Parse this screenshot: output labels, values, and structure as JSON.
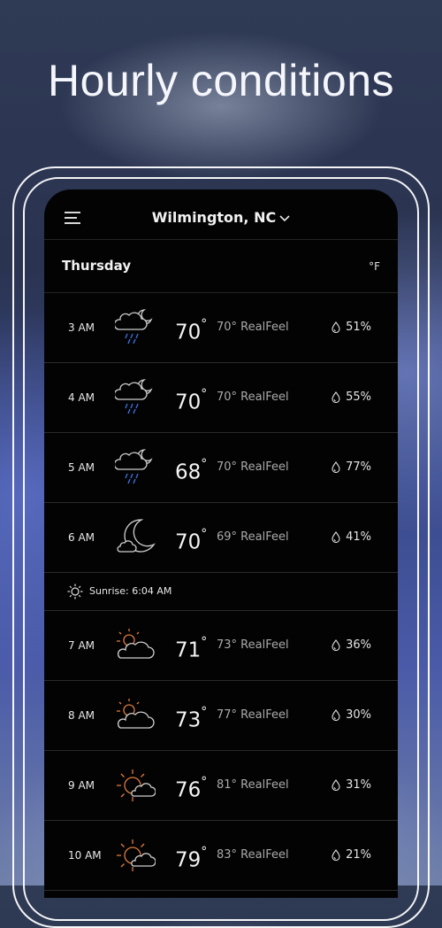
{
  "headline": "Hourly conditions",
  "header": {
    "location": "Wilmington, NC"
  },
  "day": {
    "name": "Thursday",
    "unit": "°F"
  },
  "hours_before_sunrise": [
    {
      "time": "3 AM",
      "icon": "night-cloud-rain-icon",
      "temp": "70",
      "realfeel": "70° RealFeel",
      "precip": "51%"
    },
    {
      "time": "4 AM",
      "icon": "night-cloud-rain-icon",
      "temp": "70",
      "realfeel": "70° RealFeel",
      "precip": "55%"
    },
    {
      "time": "5 AM",
      "icon": "night-cloud-rain-icon",
      "temp": "68",
      "realfeel": "70° RealFeel",
      "precip": "77%"
    },
    {
      "time": "6 AM",
      "icon": "moon-cloud-icon",
      "temp": "70",
      "realfeel": "69° RealFeel",
      "precip": "41%"
    }
  ],
  "sunrise": {
    "icon": "sun-outline-icon",
    "text": "Sunrise: 6:04 AM"
  },
  "hours_after_sunrise": [
    {
      "time": "7 AM",
      "icon": "sun-cloud-icon",
      "temp": "71",
      "realfeel": "73° RealFeel",
      "precip": "36%"
    },
    {
      "time": "8 AM",
      "icon": "sun-cloud-icon",
      "temp": "73",
      "realfeel": "77° RealFeel",
      "precip": "30%"
    },
    {
      "time": "9 AM",
      "icon": "sun-behind-cloud-icon",
      "temp": "76",
      "realfeel": "81° RealFeel",
      "precip": "31%"
    },
    {
      "time": "10 AM",
      "icon": "sun-behind-cloud-icon",
      "temp": "79",
      "realfeel": "83° RealFeel",
      "precip": "21%"
    }
  ],
  "colors": {
    "sun_orange": "#e07a3c",
    "rain_blue": "#3a6fd8",
    "icon_gray": "#cfcfcf"
  }
}
